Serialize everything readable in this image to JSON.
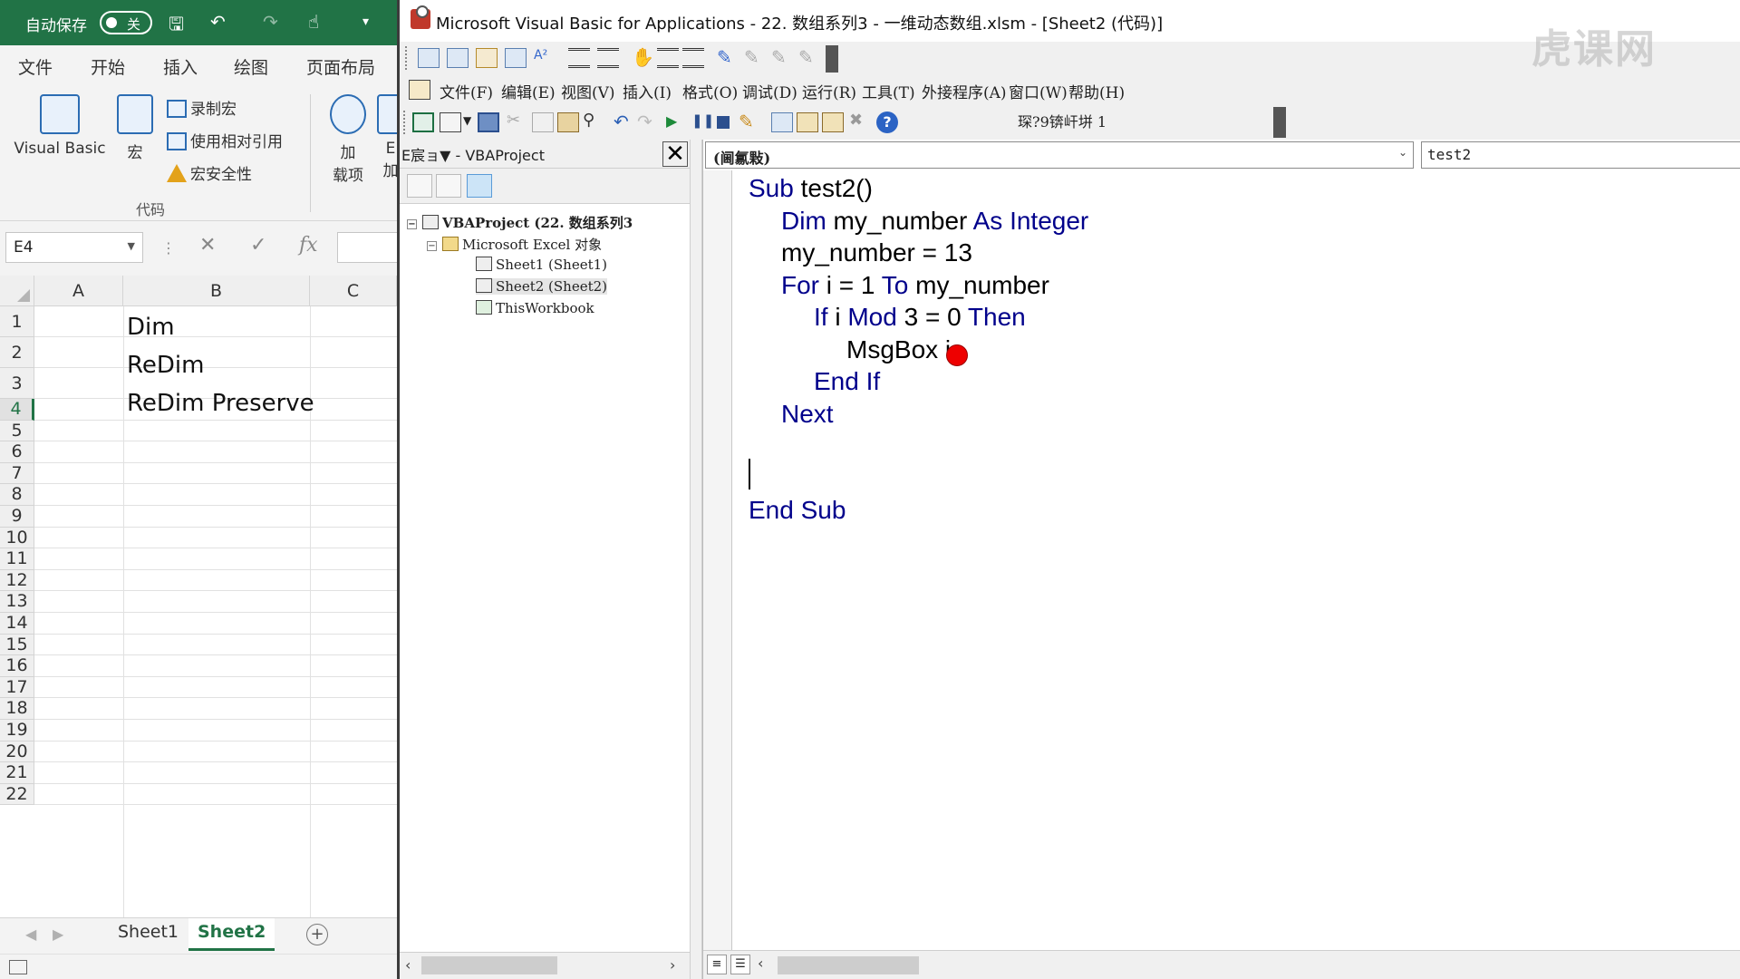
{
  "excel": {
    "titlebar": {
      "autosave_label": "自动保存",
      "toggle_state": "关"
    },
    "tabs": [
      "文件",
      "开始",
      "插入",
      "绘图",
      "页面布局"
    ],
    "ribbon": {
      "visual_basic": "Visual Basic",
      "macros": "宏",
      "record_macro": "录制宏",
      "relative_ref": "使用相对引用",
      "macro_security": "宏安全性",
      "addins_line1": "加",
      "addins_line2": "载项",
      "excel_addins_line1": "E",
      "excel_addins_line2": "加",
      "group_label": "代码"
    },
    "namebox": "E4",
    "formula_buttons": {
      "cancel": "✕",
      "enter": "✓",
      "fx": "fx"
    },
    "columns": [
      "A",
      "B",
      "C"
    ],
    "rows": [
      "1",
      "2",
      "3",
      "4",
      "5",
      "6",
      "7",
      "8",
      "9",
      "10",
      "11",
      "12",
      "13",
      "14",
      "15",
      "16",
      "17",
      "18",
      "19",
      "20",
      "21",
      "22"
    ],
    "active_row": "4",
    "cells": {
      "B1": "Dim",
      "B2": "ReDim",
      "B3": "ReDim Preserve"
    },
    "sheets": [
      "Sheet1",
      "Sheet2"
    ],
    "active_sheet": "Sheet2",
    "add_sheet": "+"
  },
  "vbe": {
    "title": "Microsoft Visual Basic for Applications - 22. 数组系列3 - 一维动态数组.xlsm - [Sheet2 (代码)]",
    "menu": [
      "文件(F)",
      "编辑(E)",
      "视图(V)",
      "插入(I)",
      "格式(O)",
      "调试(D)",
      "运行(R)",
      "工具(T)",
      "外接程序(A)",
      "窗口(W)",
      "帮助(H)"
    ],
    "status_lncol": "琛?9锛屽垪 1",
    "project": {
      "header": "E宸ョ▼ - VBAProject",
      "close": "✕",
      "root": "VBAProject (22. 数组系列3",
      "folder": "Microsoft Excel 对象",
      "items": [
        "Sheet1 (Sheet1)",
        "Sheet2 (Sheet2)",
        "ThisWorkbook"
      ],
      "selected_item": "Sheet2 (Sheet2)"
    },
    "object_combo": "(阃氱敤)",
    "procedure_combo": "test2",
    "code_lines": [
      {
        "indent": 0,
        "parts": [
          [
            "kw",
            "Sub"
          ],
          [
            "t",
            " test2()"
          ]
        ]
      },
      {
        "indent": 1,
        "parts": [
          [
            "kw",
            "Dim"
          ],
          [
            "t",
            " my_number "
          ],
          [
            "kw",
            "As Integer"
          ]
        ]
      },
      {
        "indent": 1,
        "parts": [
          [
            "t",
            "my_number = 13"
          ]
        ]
      },
      {
        "indent": 1,
        "parts": [
          [
            "kw",
            "For"
          ],
          [
            "t",
            " i = 1 "
          ],
          [
            "kw",
            "To"
          ],
          [
            "t",
            " my_number"
          ]
        ]
      },
      {
        "indent": 2,
        "parts": [
          [
            "kw",
            "If"
          ],
          [
            "t",
            " i "
          ],
          [
            "kw",
            "Mod"
          ],
          [
            "t",
            " 3 = 0 "
          ],
          [
            "kw",
            "Then"
          ]
        ]
      },
      {
        "indent": 3,
        "parts": [
          [
            "t",
            "MsgBox i"
          ]
        ]
      },
      {
        "indent": 2,
        "parts": [
          [
            "kw",
            "End If"
          ]
        ]
      },
      {
        "indent": 1,
        "parts": [
          [
            "kw",
            "Next"
          ]
        ]
      },
      {
        "indent": 0,
        "parts": []
      },
      {
        "indent": 0,
        "parts": []
      },
      {
        "indent": 0,
        "parts": [
          [
            "kw",
            "End Sub"
          ]
        ]
      }
    ]
  },
  "watermark": "虎课网",
  "colors": {
    "excel_green": "#217346",
    "vba_keyword": "#00008b",
    "breakpoint": "#e00000"
  }
}
